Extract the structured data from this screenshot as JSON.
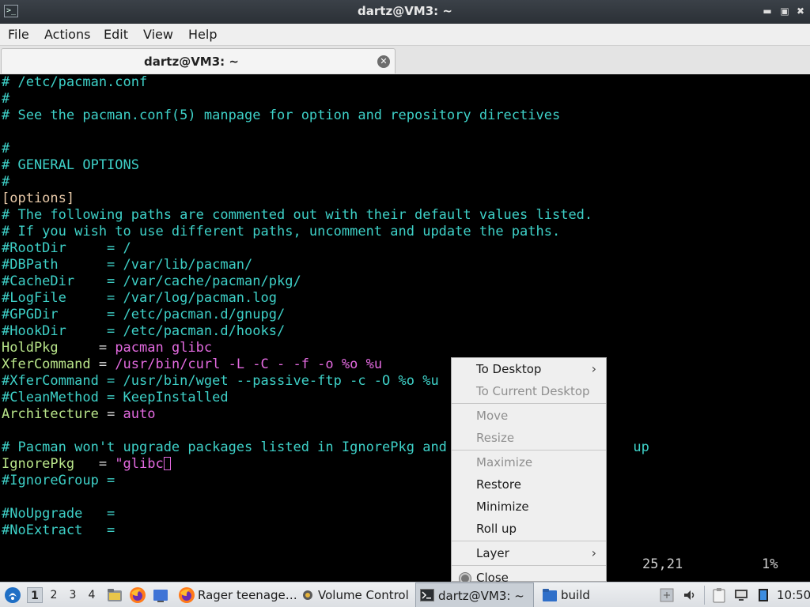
{
  "window": {
    "title": "dartz@VM3: ~"
  },
  "menubar": {
    "items": [
      "File",
      "Actions",
      "Edit",
      "View",
      "Help"
    ]
  },
  "tabs": [
    {
      "label": "dartz@VM3: ~"
    }
  ],
  "terminal": {
    "lines": [
      {
        "parts": [
          {
            "t": "# /etc/pacman.conf",
            "c": "c"
          }
        ]
      },
      {
        "parts": [
          {
            "t": "#",
            "c": "c"
          }
        ]
      },
      {
        "parts": [
          {
            "t": "# See the pacman.conf(5) manpage for option and repository directives",
            "c": "c"
          }
        ]
      },
      {
        "parts": []
      },
      {
        "parts": [
          {
            "t": "#",
            "c": "c"
          }
        ]
      },
      {
        "parts": [
          {
            "t": "# GENERAL OPTIONS",
            "c": "c"
          }
        ]
      },
      {
        "parts": [
          {
            "t": "#",
            "c": "c"
          }
        ]
      },
      {
        "parts": [
          {
            "t": "[options]",
            "c": "o"
          }
        ]
      },
      {
        "parts": [
          {
            "t": "# The following paths are commented out with their default values listed.",
            "c": "c"
          }
        ]
      },
      {
        "parts": [
          {
            "t": "# If you wish to use different paths, uncomment and update the paths.",
            "c": "c"
          }
        ]
      },
      {
        "parts": [
          {
            "t": "#RootDir     = /",
            "c": "c"
          }
        ]
      },
      {
        "parts": [
          {
            "t": "#DBPath      = /var/lib/pacman/",
            "c": "c"
          }
        ]
      },
      {
        "parts": [
          {
            "t": "#CacheDir    = /var/cache/pacman/pkg/",
            "c": "c"
          }
        ]
      },
      {
        "parts": [
          {
            "t": "#LogFile     = /var/log/pacman.log",
            "c": "c"
          }
        ]
      },
      {
        "parts": [
          {
            "t": "#GPGDir      = /etc/pacman.d/gnupg/",
            "c": "c"
          }
        ]
      },
      {
        "parts": [
          {
            "t": "#HookDir     = /etc/pacman.d/hooks/",
            "c": "c"
          }
        ]
      },
      {
        "parts": [
          {
            "t": "HoldPkg     ",
            "c": "k"
          },
          {
            "t": "= ",
            "c": "w"
          },
          {
            "t": "pacman glibc",
            "c": "v"
          }
        ]
      },
      {
        "parts": [
          {
            "t": "XferCommand ",
            "c": "k"
          },
          {
            "t": "= ",
            "c": "w"
          },
          {
            "t": "/usr/bin/curl -L -C - -f -o %o %u",
            "c": "v"
          }
        ]
      },
      {
        "parts": [
          {
            "t": "#XferCommand = /usr/bin/wget --passive-ftp -c -O %o %u",
            "c": "c"
          }
        ]
      },
      {
        "parts": [
          {
            "t": "#CleanMethod = KeepInstalled",
            "c": "c"
          }
        ]
      },
      {
        "parts": [
          {
            "t": "Architecture ",
            "c": "k"
          },
          {
            "t": "= ",
            "c": "w"
          },
          {
            "t": "auto",
            "c": "v"
          }
        ]
      },
      {
        "parts": []
      },
      {
        "parts": [
          {
            "t": "# Pacman won't upgrade packages listed in IgnorePkg and m",
            "c": "c"
          },
          {
            "t": "                     ",
            "c": "c"
          },
          {
            "t": "up",
            "c": "c"
          }
        ]
      },
      {
        "parts": [
          {
            "t": "IgnorePkg   ",
            "c": "k"
          },
          {
            "t": "= ",
            "c": "w"
          },
          {
            "t": "\"glibc",
            "c": "v"
          },
          {
            "t": "CURSOR",
            "c": "cur"
          }
        ]
      },
      {
        "parts": [
          {
            "t": "#IgnoreGroup =",
            "c": "c"
          }
        ]
      },
      {
        "parts": []
      },
      {
        "parts": [
          {
            "t": "#NoUpgrade   =",
            "c": "c"
          }
        ]
      },
      {
        "parts": [
          {
            "t": "#NoExtract   =",
            "c": "c"
          }
        ]
      }
    ],
    "status_position": "25,21",
    "status_percent": "1%"
  },
  "context_menu": {
    "items": [
      {
        "label": "To Desktop",
        "disabled": false,
        "submenu": true
      },
      {
        "label": "To Current Desktop",
        "disabled": true
      },
      {
        "sep": true
      },
      {
        "label": "Move",
        "disabled": true
      },
      {
        "label": "Resize",
        "disabled": true
      },
      {
        "sep": true
      },
      {
        "label": "Maximize",
        "disabled": true
      },
      {
        "label": "Restore",
        "disabled": false
      },
      {
        "label": "Minimize",
        "disabled": false
      },
      {
        "label": "Roll up",
        "disabled": false
      },
      {
        "sep": true
      },
      {
        "label": "Layer",
        "disabled": false,
        "submenu": true
      },
      {
        "sep": true
      },
      {
        "label": "Close",
        "disabled": false,
        "radio": true
      }
    ]
  },
  "taskbar": {
    "workspaces": [
      "1",
      "2",
      "3",
      "4"
    ],
    "active_workspace": "1",
    "tasks": [
      {
        "label": "Rager teenage…",
        "icon": "firefox-icon"
      },
      {
        "label": "Volume Control",
        "icon": "volume-control-icon"
      },
      {
        "label": "dartz@VM3: ~",
        "icon": "terminal-icon",
        "active": true
      },
      {
        "label": "build",
        "icon": "folder-icon"
      }
    ],
    "clock": "10:50"
  }
}
